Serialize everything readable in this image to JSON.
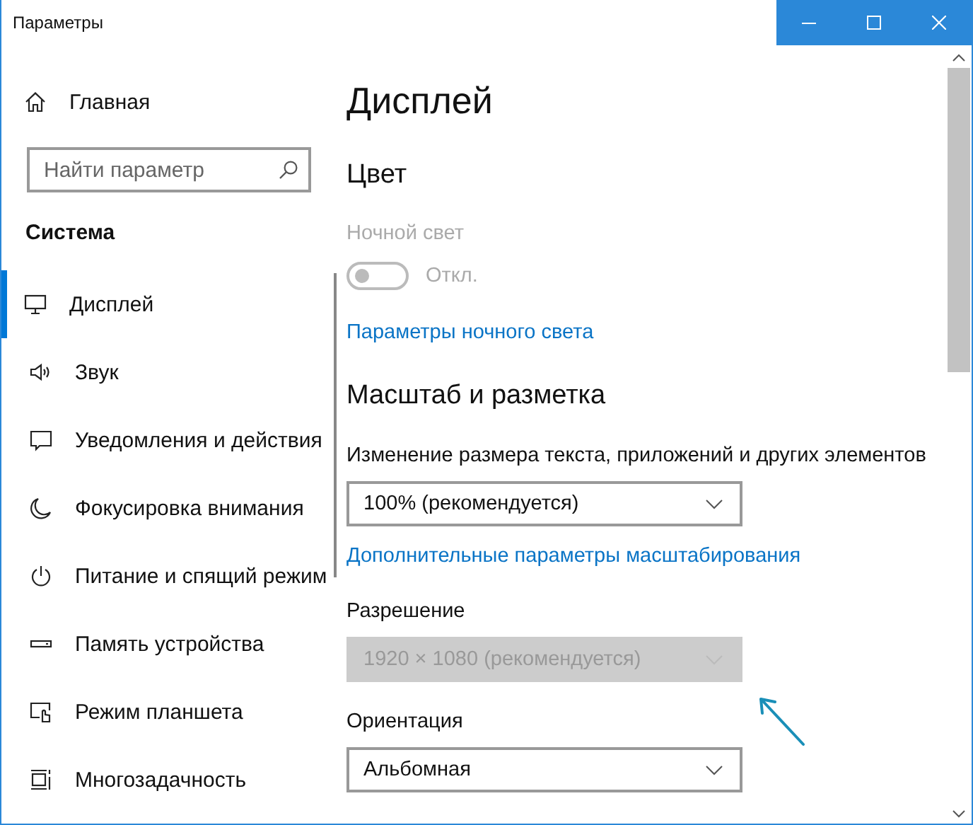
{
  "window": {
    "title": "Параметры"
  },
  "sidebar": {
    "home": "Главная",
    "search": {
      "placeholder": "Найти параметр"
    },
    "section": "Система",
    "items": [
      {
        "label": "Дисплей",
        "selected": true
      },
      {
        "label": "Звук",
        "selected": false
      },
      {
        "label": "Уведомления и действия",
        "selected": false
      },
      {
        "label": "Фокусировка внимания",
        "selected": false
      },
      {
        "label": "Питание и спящий режим",
        "selected": false
      },
      {
        "label": "Память устройства",
        "selected": false
      },
      {
        "label": "Режим планшета",
        "selected": false
      },
      {
        "label": "Многозадачность",
        "selected": false
      }
    ]
  },
  "content": {
    "title": "Дисплей",
    "blocks": [
      {
        "kind": "heading",
        "text": "Цвет"
      },
      {
        "kind": "toggle",
        "label": "Ночной свет",
        "state_text": "Откл.",
        "on": false,
        "disabled": true
      },
      {
        "kind": "link",
        "text": "Параметры ночного света"
      },
      {
        "kind": "heading",
        "text": "Масштаб и разметка"
      },
      {
        "kind": "dropdown",
        "label": "Изменение размера текста, приложений и других элементов",
        "value": "100% (рекомендуется)",
        "disabled": false
      },
      {
        "kind": "link",
        "text": "Дополнительные параметры масштабирования"
      },
      {
        "kind": "dropdown",
        "label": "Разрешение",
        "value": "1920 × 1080 (рекомендуется)",
        "disabled": true
      },
      {
        "kind": "dropdown",
        "label": "Ориентация",
        "value": "Альбомная",
        "disabled": false
      }
    ]
  }
}
